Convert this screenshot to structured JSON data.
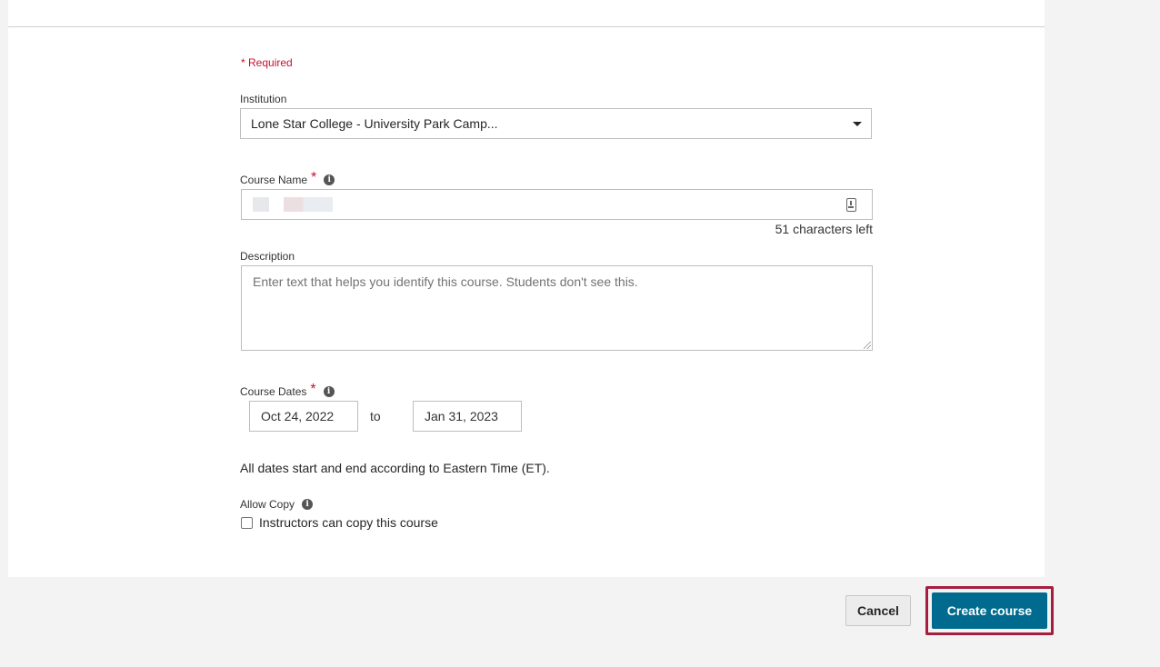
{
  "form": {
    "required_note": "* Required",
    "institution": {
      "label": "Institution",
      "selected": "Lone Star College - University Park Camp..."
    },
    "course_name": {
      "label": "Course Name",
      "required_marker": "*",
      "value": "",
      "chars_left": "51 characters left"
    },
    "description": {
      "label": "Description",
      "placeholder": "Enter text that helps you identify this course. Students don't see this."
    },
    "course_dates": {
      "label": "Course Dates",
      "required_marker": "*",
      "start": "Oct 24, 2022",
      "separator": "to",
      "end": "Jan 31, 2023",
      "timezone_note": "All dates start and end according to Eastern Time (ET)."
    },
    "allow_copy": {
      "label": "Allow Copy",
      "checkbox_label": "Instructors can copy this course",
      "checked": false
    }
  },
  "footer": {
    "cancel_label": "Cancel",
    "create_label": "Create course"
  },
  "colors": {
    "required": "#c8102e",
    "primary_button": "#006b8f",
    "highlight_border": "#a61d3f"
  },
  "icons": {
    "info": "info-icon",
    "dropdown": "caret-down-icon",
    "input_helper": "keyboard-icon"
  }
}
